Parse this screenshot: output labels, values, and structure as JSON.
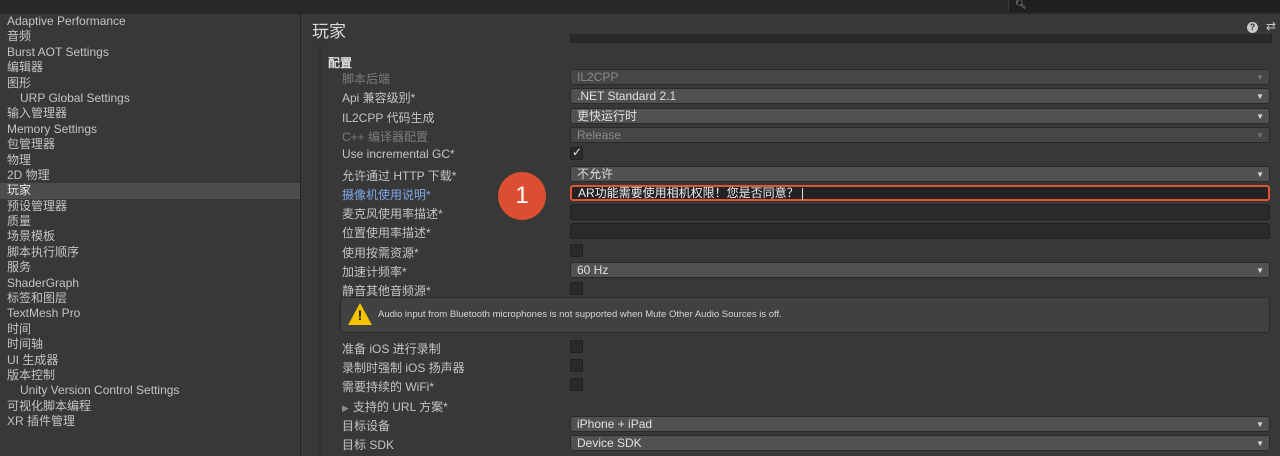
{
  "sidebar": {
    "items": [
      {
        "label": "Adaptive Performance",
        "indent": false,
        "selected": false
      },
      {
        "label": "音频",
        "indent": false,
        "selected": false
      },
      {
        "label": "Burst AOT Settings",
        "indent": false,
        "selected": false
      },
      {
        "label": "编辑器",
        "indent": false,
        "selected": false
      },
      {
        "label": "图形",
        "indent": false,
        "selected": false
      },
      {
        "label": "URP Global Settings",
        "indent": true,
        "selected": false
      },
      {
        "label": "输入管理器",
        "indent": false,
        "selected": false
      },
      {
        "label": "Memory Settings",
        "indent": false,
        "selected": false
      },
      {
        "label": "包管理器",
        "indent": false,
        "selected": false
      },
      {
        "label": "物理",
        "indent": false,
        "selected": false
      },
      {
        "label": "2D 物理",
        "indent": false,
        "selected": false
      },
      {
        "label": "玩家",
        "indent": false,
        "selected": true
      },
      {
        "label": "预设管理器",
        "indent": false,
        "selected": false
      },
      {
        "label": "质量",
        "indent": false,
        "selected": false
      },
      {
        "label": "场景模板",
        "indent": false,
        "selected": false
      },
      {
        "label": "脚本执行顺序",
        "indent": false,
        "selected": false
      },
      {
        "label": "服务",
        "indent": false,
        "selected": false
      },
      {
        "label": "ShaderGraph",
        "indent": false,
        "selected": false
      },
      {
        "label": "标签和图层",
        "indent": false,
        "selected": false
      },
      {
        "label": "TextMesh Pro",
        "indent": false,
        "selected": false
      },
      {
        "label": "时间",
        "indent": false,
        "selected": false
      },
      {
        "label": "时间轴",
        "indent": false,
        "selected": false
      },
      {
        "label": "UI 生成器",
        "indent": false,
        "selected": false
      },
      {
        "label": "版本控制",
        "indent": false,
        "selected": false
      },
      {
        "label": "Unity Version Control Settings",
        "indent": true,
        "selected": false
      },
      {
        "label": "可视化脚本编程",
        "indent": false,
        "selected": false
      },
      {
        "label": "XR 插件管理",
        "indent": false,
        "selected": false
      }
    ]
  },
  "main": {
    "title": "玩家",
    "section": "配置",
    "badge": "1",
    "warning": "Audio input from Bluetooth microphones is not supported when Mute Other Audio Sources is off.",
    "rows": [
      {
        "name": "scripting-backend",
        "label": "脚本后端",
        "type": "dropdown",
        "value": "IL2CPP",
        "disabled": true
      },
      {
        "name": "api-compat",
        "label": "Api 兼容级别*",
        "type": "dropdown",
        "value": ".NET Standard 2.1"
      },
      {
        "name": "il2cpp-codegen",
        "label": "IL2CPP 代码生成",
        "type": "dropdown",
        "value": "更快运行时"
      },
      {
        "name": "cpp-compiler-config",
        "label": "C++ 编译器配置",
        "type": "dropdown",
        "value": "Release",
        "disabled": true
      },
      {
        "name": "incremental-gc",
        "label": "Use incremental GC*",
        "type": "checkbox",
        "checked": true
      },
      {
        "name": "http-download",
        "label": "允许通过 HTTP 下载*",
        "type": "dropdown",
        "value": "不允许"
      },
      {
        "name": "camera-usage",
        "label": "摄像机使用说明*",
        "type": "text",
        "value": "AR功能需要使用相机权限！您是否同意？",
        "link": true,
        "highlight": true
      },
      {
        "name": "mic-usage",
        "label": "麦克风使用率描述*",
        "type": "text",
        "value": ""
      },
      {
        "name": "location-usage",
        "label": "位置使用率描述*",
        "type": "text",
        "value": ""
      },
      {
        "name": "on-demand-resources",
        "label": "使用按需资源*",
        "type": "checkbox",
        "checked": false
      },
      {
        "name": "accelerometer-frequency",
        "label": "加速计频率*",
        "type": "dropdown",
        "value": "60 Hz"
      },
      {
        "name": "mute-other-audio",
        "label": "静音其他音频源*",
        "type": "checkbox",
        "checked": false
      },
      {
        "name": "prepare-ios-recording",
        "label": "准备 iOS 进行录制",
        "type": "checkbox",
        "checked": false,
        "gapBefore": true
      },
      {
        "name": "force-ios-speaker",
        "label": "录制时强制 iOS 扬声器",
        "type": "checkbox",
        "checked": false
      },
      {
        "name": "requires-wifi",
        "label": "需要持续的 WiFi*",
        "type": "checkbox",
        "checked": false
      },
      {
        "name": "url-schemes",
        "label": "支持的 URL 方案*",
        "type": "foldout"
      },
      {
        "name": "target-device",
        "label": "目标设备",
        "type": "dropdown",
        "value": "iPhone + iPad"
      },
      {
        "name": "target-sdk",
        "label": "目标 SDK",
        "type": "dropdown",
        "value": "Device SDK"
      }
    ]
  },
  "colors": {
    "highlight": "#e05436",
    "badge": "#dc4e31",
    "warning": "#f5c400",
    "link": "#7ea7e8"
  }
}
